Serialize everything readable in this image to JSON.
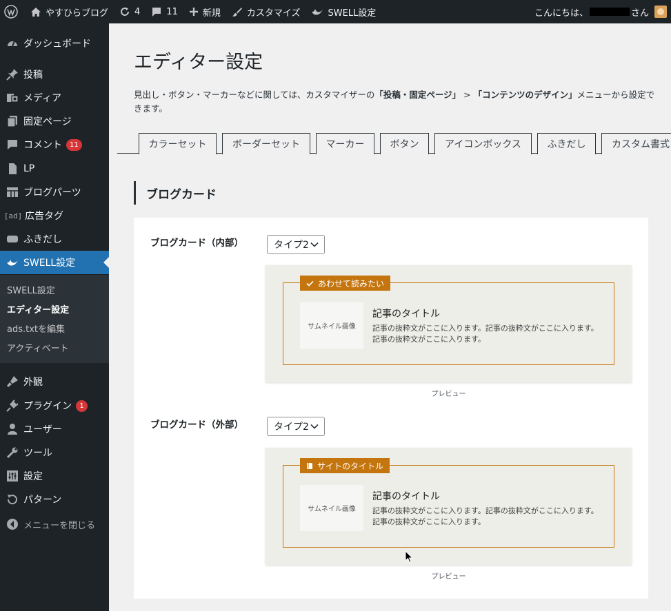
{
  "adminbar": {
    "site_name": "やすひらブログ",
    "updates_count": "4",
    "comments_count": "11",
    "new_label": "新規",
    "customize_label": "カスタマイズ",
    "swell_label": "SWELL設定",
    "greeting_prefix": "こんにちは、",
    "greeting_suffix": "さん"
  },
  "sidebar": {
    "items": [
      {
        "label": "ダッシュボード",
        "icon": "dashboard-icon"
      },
      {
        "label": "投稿",
        "icon": "pin-icon"
      },
      {
        "label": "メディア",
        "icon": "media-icon"
      },
      {
        "label": "固定ページ",
        "icon": "page-icon"
      },
      {
        "label": "コメント",
        "icon": "comment-icon",
        "badge": "11"
      },
      {
        "label": "LP",
        "icon": "document-icon"
      },
      {
        "label": "ブログパーツ",
        "icon": "grid-icon"
      },
      {
        "label": "広告タグ",
        "icon": "ad-icon"
      },
      {
        "label": "ふきだし",
        "icon": "balloon-icon"
      },
      {
        "label": "SWELL設定",
        "icon": "swell-icon"
      },
      {
        "label": "外観",
        "icon": "brush-icon"
      },
      {
        "label": "プラグイン",
        "icon": "plugin-icon",
        "badge": "1"
      },
      {
        "label": "ユーザー",
        "icon": "user-icon"
      },
      {
        "label": "ツール",
        "icon": "wrench-icon"
      },
      {
        "label": "設定",
        "icon": "settings-icon"
      },
      {
        "label": "パターン",
        "icon": "pattern-icon"
      }
    ],
    "submenu": [
      "SWELL設定",
      "エディター設定",
      "ads.txtを編集",
      "アクティベート"
    ],
    "collapse_label": "メニューを閉じる"
  },
  "page": {
    "title": "エディター設定",
    "desc_part1": "見出し・ボタン・マーカーなどに関しては、カスタマイザーの",
    "desc_bold1": "「投稿・固定ページ」",
    "desc_part2": " > ",
    "desc_bold2": "「コンテンツのデザイン」",
    "desc_part3": "メニューから設定できます。",
    "tabs": [
      "カラーセット",
      "ボーダーセット",
      "マーカー",
      "ボタン",
      "アイコンボックス",
      "ふきだし",
      "カスタム書式"
    ],
    "section_title": "ブログカード"
  },
  "blogcards": [
    {
      "label": "ブログカード（内部）",
      "select_value": "タイプ2",
      "caption": "あわせて読みたい",
      "caption_icon": "check-icon",
      "thumb": "サムネイル画像",
      "title": "記事のタイトル",
      "excerpt": "記事の抜粋文がここに入ります。記事の抜粋文がここに入ります。記事の抜粋文がここに入ります。",
      "preview_label": "プレビュー"
    },
    {
      "label": "ブログカード（外部）",
      "select_value": "タイプ2",
      "caption": "サイトのタイトル",
      "caption_icon": "book-icon",
      "thumb": "サムネイル画像",
      "title": "記事のタイトル",
      "excerpt": "記事の抜粋文がここに入ります。記事の抜粋文がここに入ります。記事の抜粋文がここに入ります。",
      "preview_label": "プレビュー"
    }
  ],
  "colors": {
    "adminbar_bg": "#1d2327",
    "active_menu": "#2271b1",
    "accent": "#c4750e",
    "badge": "#d63638"
  }
}
